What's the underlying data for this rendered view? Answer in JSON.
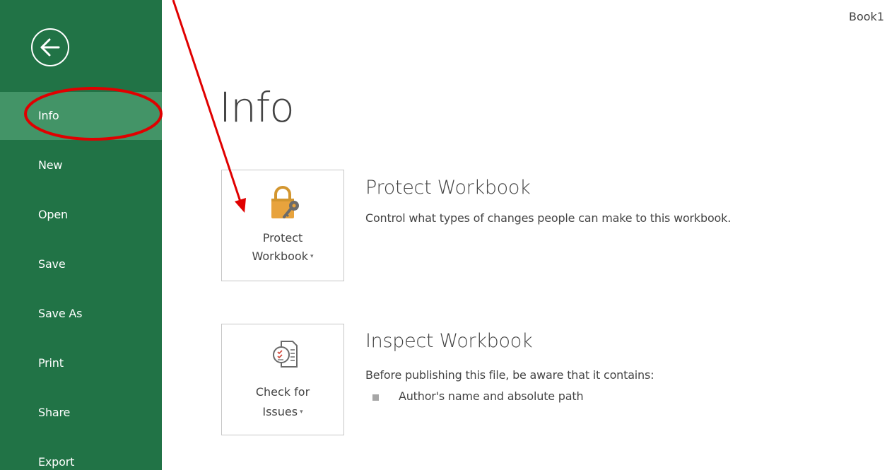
{
  "document": {
    "title": "Book1"
  },
  "sidebar": {
    "back_icon": "back-arrow-icon",
    "items": [
      {
        "label": "Info",
        "active": true
      },
      {
        "label": "New"
      },
      {
        "label": "Open"
      },
      {
        "label": "Save"
      },
      {
        "label": "Save As"
      },
      {
        "label": "Print"
      },
      {
        "label": "Share"
      },
      {
        "label": "Export"
      }
    ]
  },
  "main": {
    "title": "Info",
    "sections": [
      {
        "button_line1": "Protect",
        "button_line2": "Workbook",
        "icon": "lock-key-icon",
        "heading": "Protect Workbook",
        "description": "Control what types of changes people can make to this workbook."
      },
      {
        "button_line1": "Check for",
        "button_line2": "Issues",
        "icon": "inspect-document-icon",
        "heading": "Inspect Workbook",
        "description": "Before publishing this file, be aware that it contains:",
        "bullets": [
          "Author's name and absolute path"
        ]
      }
    ]
  },
  "colors": {
    "sidebar": "#217346",
    "sidebar_active": "#439467",
    "annotation": "#e00000",
    "lock_gold": "#e8a33d"
  },
  "annotations": [
    "red-ellipse-highlight",
    "red-arrow-pointer"
  ]
}
